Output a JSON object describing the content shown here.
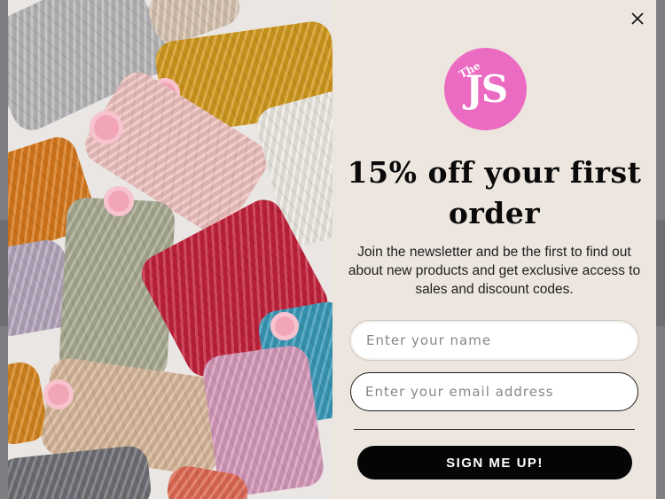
{
  "popup": {
    "close_label": "close",
    "logo": {
      "small_text": "The",
      "big_text": "JS",
      "color": "#ec6bc2"
    },
    "headline": "15% off your first order",
    "description": "Join the newsletter and be the first to find out about new products and get exclusive access to sales and discount codes.",
    "name_field": {
      "placeholder": "Enter your name",
      "value": ""
    },
    "email_field": {
      "placeholder": "Enter your email address",
      "value": ""
    },
    "submit_label": "SIGN ME UP!"
  },
  "colors": {
    "panel_bg": "#ece6df",
    "button_bg": "#050505",
    "accent": "#ec6bc2"
  },
  "icons": [
    "close-icon"
  ]
}
